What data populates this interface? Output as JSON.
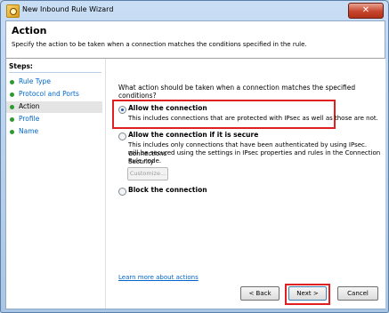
{
  "window": {
    "title": "New Inbound Rule Wizard",
    "close_glyph": "✕"
  },
  "header": {
    "title": "Action",
    "description": "Specify the action to be taken when a connection matches the conditions specified in the rule."
  },
  "sidebar": {
    "steps_label": "Steps:",
    "items": [
      {
        "label": "Rule Type",
        "active": false
      },
      {
        "label": "Protocol and Ports",
        "active": false
      },
      {
        "label": "Action",
        "active": true
      },
      {
        "label": "Profile",
        "active": false
      },
      {
        "label": "Name",
        "active": false
      }
    ]
  },
  "main": {
    "question": "What action should be taken when a connection matches the specified conditions?",
    "options": [
      {
        "label": "Allow the connection",
        "description": "This includes connections that are protected with IPsec as well as those are not.",
        "selected": true
      },
      {
        "label": "Allow the connection if it is secure",
        "description_lines": [
          "This includes only connections that have been authenticated by using IPsec.  Connections",
          "will be secured using the settings in IPsec properties and rules in the Connection Security",
          "Rule node."
        ],
        "selected": false
      },
      {
        "label": "Block the connection",
        "selected": false
      }
    ],
    "customize_label": "Customize...",
    "learn_more": "Learn more about actions"
  },
  "footer": {
    "back_label": "< Back",
    "next_label": "Next >",
    "cancel_label": "Cancel"
  },
  "colors": {
    "highlight": "#e02020",
    "link": "#0066cc",
    "step_bullet": "#2d9a2d"
  },
  "icons": {
    "app": "firewall-wizard-icon",
    "close": "close-icon",
    "step": "green-bullet-icon"
  }
}
